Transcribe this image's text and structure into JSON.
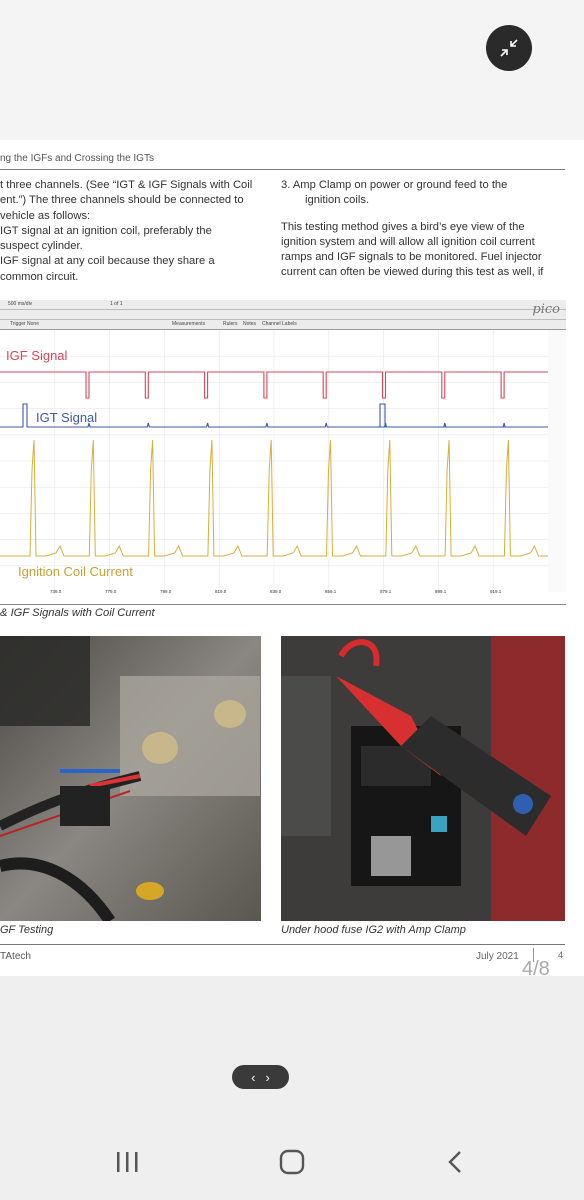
{
  "header": {
    "running_head": "ng the IGFs and Crossing the IGTs"
  },
  "left_column": [
    "t three channels. (See “IGT & IGF Signals with Coil",
    "ent.”) The three channels should be connected to",
    "vehicle as follows:",
    "IGT signal at an ignition coil, preferably the",
    "suspect cylinder.",
    "IGF signal at any coil because they share a",
    "common circuit."
  ],
  "right_column": {
    "list_item": "3.  Amp Clamp on power or ground feed to the",
    "list_item_cont": "ignition coils.",
    "paragraph": [
      "This testing method gives a bird’s eye view of the",
      "ignition system and will allow all ignition coil current",
      "ramps and IGF signals to be monitored. Fuel injector",
      "current can often be viewed during this test as well, if"
    ]
  },
  "scope": {
    "logo": "pico",
    "toolbar_text_1": "500 ms/div",
    "toolbar_text_2": "1 of 1",
    "toolbar_text_3": "Trigger  None",
    "toolbar_text_4": "Measurements",
    "toolbar_text_5": "Rulers",
    "toolbar_text_6": "Notes",
    "toolbar_text_7": "Channel Labels",
    "labels": {
      "igf": "IGF Signal",
      "igt": "IGT Signal",
      "coil": "Ignition Coil Current"
    },
    "x_ticks": [
      "739.0",
      "779.0",
      "799.0",
      "819.0",
      "839.0",
      "859.1",
      "879.1",
      "899.1",
      "919.1"
    ],
    "colors": {
      "igf": "#d9455a",
      "igt": "#3d5aa8",
      "coil": "#d8ad3a"
    }
  },
  "figure_caption": "& IGF Signals with Coil Current",
  "photos": {
    "left_caption": "GF Testing",
    "right_caption": "Under hood fuse IG2 with Amp Clamp"
  },
  "footer": {
    "publisher": "TAtech",
    "date": "July 2021",
    "page_number": "4",
    "page_indicator": "4/8"
  },
  "controls": {
    "collapse_icon": "collapse-arrows-icon",
    "pager_prev": "‹",
    "pager_next": "›"
  }
}
